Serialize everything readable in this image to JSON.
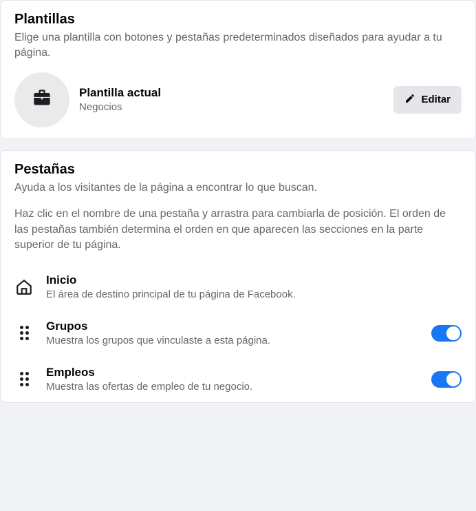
{
  "templates_card": {
    "title": "Plantillas",
    "subtitle": "Elige una plantilla con botones y pestañas predeterminados diseñados para ayudar a tu página.",
    "current_template_label": "Plantilla actual",
    "current_template_type": "Negocios",
    "edit_label": "Editar"
  },
  "tabs_card": {
    "title": "Pestañas",
    "subtitle": "Ayuda a los visitantes de la página a encontrar lo que buscan.",
    "hint": "Haz clic en el nombre de una pestaña y arrastra para cambiarla de posición. El orden de las pestañas también determina el orden en que aparecen las secciones en la parte superior de tu página.",
    "items": [
      {
        "title": "Inicio",
        "description": "El área de destino principal de tu página de Facebook."
      },
      {
        "title": "Grupos",
        "description": "Muestra los grupos que vinculaste a esta página."
      },
      {
        "title": "Empleos",
        "description": "Muestra las ofertas de empleo de tu negocio."
      }
    ]
  }
}
